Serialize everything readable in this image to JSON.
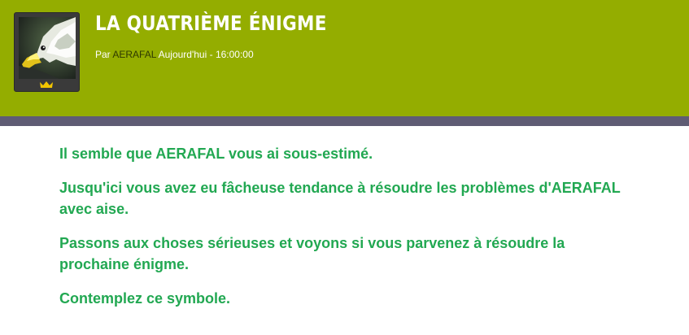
{
  "post": {
    "title": "LA QUATRIÈME ÉNIGME",
    "by_prefix": "Par",
    "author": "AERAFAL",
    "date": "Aujourd'hui - 16:00:00",
    "rank_icon": "crown-icon",
    "avatar_icon": "eagle-avatar"
  },
  "body": {
    "paragraphs": [
      "Il semble que AERAFAL vous ai sous-estimé.",
      "Jusqu'ici vous avez eu fâcheuse tendance à résoudre les problèmes d'AERAFAL avec aise.",
      "Passons aux choses sérieuses et voyons si vous parvenez à résoudre la prochaine énigme.",
      "Contemplez ce symbole."
    ]
  },
  "colors": {
    "header_bg": "#94ad00",
    "divider": "#5f5c74",
    "text_green": "#22a852",
    "crown": "#f2c500"
  }
}
